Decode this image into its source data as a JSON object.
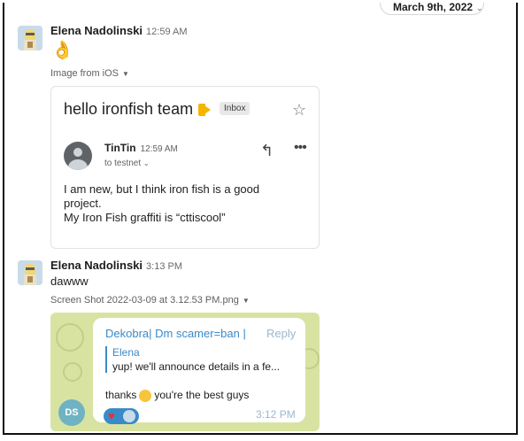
{
  "date_divider": {
    "label": "March 9th, 2022"
  },
  "messages": [
    {
      "sender": "Elena Nadolinski",
      "time": "12:59 AM",
      "emoji": "👌",
      "attachment_label": "Image from iOS",
      "email": {
        "subject": "hello ironfish team",
        "label": "Inbox",
        "from": "TinTin",
        "time": "12:59 AM",
        "to": "to testnet",
        "body_lines": [
          "I am new, but I think iron fish is a good",
          "project.",
          "My Iron Fish graffiti  is “cttiscool”"
        ]
      }
    },
    {
      "sender": "Elena Nadolinski",
      "time": "3:13 PM",
      "text": "dawww",
      "attachment_label": "Screen Shot 2022-03-09 at 3.12.53 PM.png",
      "telegram": {
        "header": "Dekobra| Dm scamer=ban |",
        "reply_label": "Reply",
        "quote_name": "Elena",
        "quote_text": "yup! we'll announce details in a fe...",
        "message_before": "thanks",
        "message_after": "you're the best guys",
        "time": "3:12 PM",
        "avatar_initials": "DS"
      }
    }
  ],
  "colors": {
    "telegram_link": "#3a8ac8",
    "label_yellow": "#f4b400",
    "telegram_bg": "#d8e3a2"
  }
}
